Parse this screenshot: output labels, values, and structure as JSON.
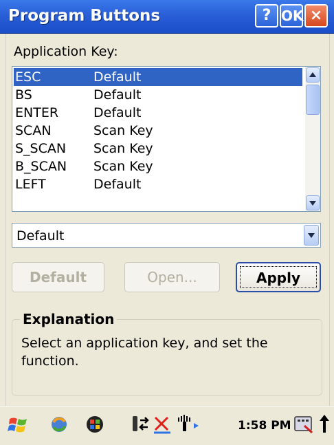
{
  "window": {
    "title": "Program Buttons",
    "help_label": "?",
    "ok_label": "OK",
    "close_label": "×"
  },
  "application_key_label": "Application Key:",
  "key_list": [
    {
      "key": "ESC",
      "function": "Default",
      "selected": true
    },
    {
      "key": "BS",
      "function": "Default",
      "selected": false
    },
    {
      "key": "ENTER",
      "function": "Default",
      "selected": false
    },
    {
      "key": "SCAN",
      "function": "Scan Key",
      "selected": false
    },
    {
      "key": "S_SCAN",
      "function": "Scan Key",
      "selected": false
    },
    {
      "key": "B_SCAN",
      "function": "Scan Key",
      "selected": false
    },
    {
      "key": "LEFT",
      "function": "Default",
      "selected": false
    }
  ],
  "function_select": {
    "value": "Default"
  },
  "buttons": {
    "default_label": "Default",
    "open_label": "Open...",
    "apply_label": "Apply"
  },
  "explanation": {
    "title": "Explanation",
    "text": "Select an application key, and set the function."
  },
  "taskbar": {
    "clock": "1:58 PM",
    "icons": [
      "start-icon",
      "sync-icon",
      "app-icon",
      "connection-icon",
      "network-error-icon",
      "signal-icon",
      "keyboard-icon",
      "scroll-up-icon"
    ]
  },
  "colors": {
    "titlebar": "#2a5fd8",
    "selection": "#2f63c4",
    "dialog_background": "#ece9d8"
  }
}
